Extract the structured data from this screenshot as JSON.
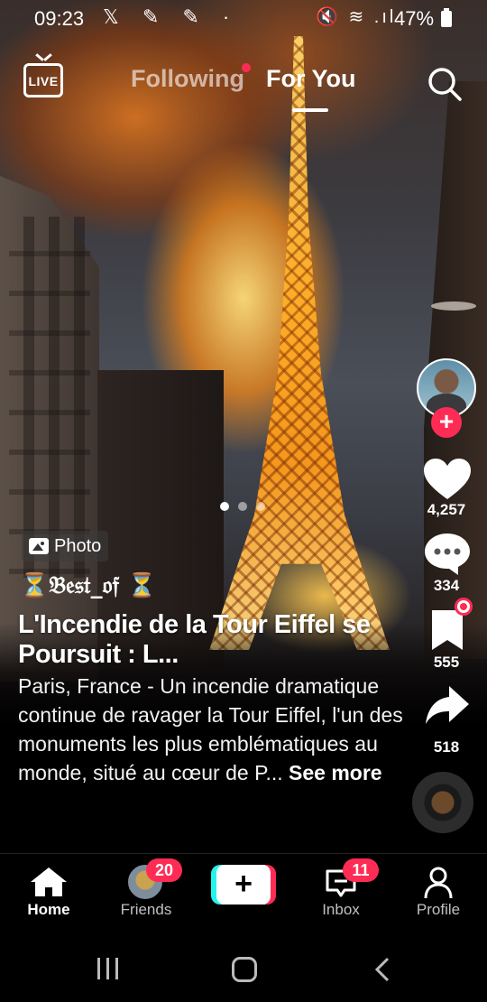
{
  "status_bar": {
    "time": "09:23",
    "left_icons": "𝕏 ✎ ✎ ·",
    "right_icons": "🔇 ≋ .ıl",
    "battery": "47%"
  },
  "top_nav": {
    "live_label": "LIVE",
    "tabs": [
      {
        "label": "Following",
        "active": false,
        "has_dot": true
      },
      {
        "label": "For You",
        "active": true
      }
    ]
  },
  "post": {
    "photo_tag": "Photo",
    "username": "⏳𝔅𝔢𝔰𝔱_𝔬𝔣 ⏳",
    "title": "L'Incendie de la Tour Eiffel se Poursuit : L...",
    "description": "Paris, France - Un incendie dramatique continue de ravager la Tour Eiffel, l'un des monuments les plus emblématiques au monde, situé au cœur de P...",
    "see_more": "See more",
    "carousel_count": 3,
    "carousel_active_index": 0
  },
  "actions": {
    "likes": "4,257",
    "comments": "334",
    "saves": "555",
    "shares": "518",
    "follow_symbol": "+"
  },
  "bottom_nav": {
    "items": [
      {
        "label": "Home",
        "icon": "home-icon",
        "active": true
      },
      {
        "label": "Friends",
        "icon": "friends-avatar",
        "badge": "20"
      },
      {
        "label": "",
        "icon": "create-plus-icon",
        "symbol": "+"
      },
      {
        "label": "Inbox",
        "icon": "inbox-icon",
        "badge": "11"
      },
      {
        "label": "Profile",
        "icon": "profile-icon"
      }
    ]
  },
  "colors": {
    "accent": "#fe2c55",
    "cyan": "#25f4ee",
    "background": "#000000"
  }
}
